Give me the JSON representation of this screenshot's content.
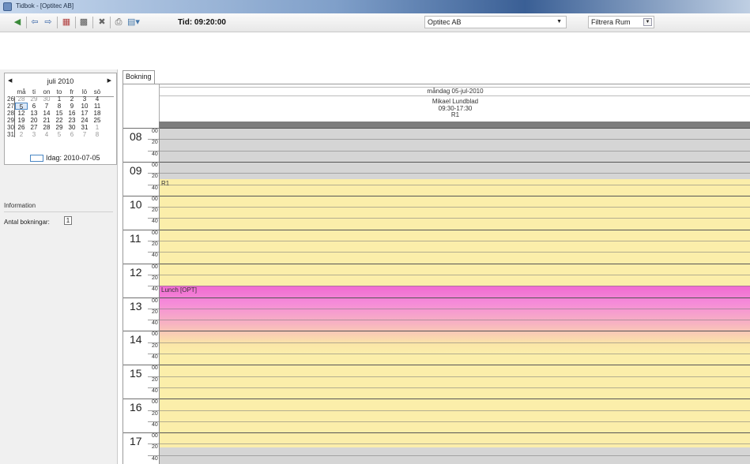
{
  "window": {
    "title": "Tidbok - [Optitec AB]"
  },
  "toolbar": {
    "icons": [
      "exit-icon",
      "back-icon",
      "forward-icon",
      "calendar-icon",
      "week-icon",
      "tools-icon",
      "print-icon",
      "report-icon"
    ],
    "time_label": "Tid: 09:20:00",
    "company": "Optitec AB",
    "filter": "Filtrera Rum"
  },
  "calendar": {
    "month": "juli 2010",
    "weekday_headers": [
      "må",
      "ti",
      "on",
      "to",
      "fr",
      "lö",
      "sö"
    ],
    "weeks": [
      {
        "week": "26",
        "days": [
          "28",
          "29",
          "30",
          "1",
          "2",
          "3",
          "4"
        ]
      },
      {
        "week": "27",
        "days": [
          "5",
          "6",
          "7",
          "8",
          "9",
          "10",
          "11"
        ]
      },
      {
        "week": "28",
        "days": [
          "12",
          "13",
          "14",
          "15",
          "16",
          "17",
          "18"
        ]
      },
      {
        "week": "29",
        "days": [
          "19",
          "20",
          "21",
          "22",
          "23",
          "24",
          "25"
        ]
      },
      {
        "week": "30",
        "days": [
          "26",
          "27",
          "28",
          "29",
          "30",
          "31",
          "1"
        ]
      },
      {
        "week": "31",
        "days": [
          "2",
          "3",
          "4",
          "5",
          "6",
          "7",
          "8"
        ]
      }
    ],
    "selected_day": "5",
    "today": "Idag: 2010-07-05"
  },
  "info": {
    "title": "Information",
    "bookings_label": "Antal bokningar:",
    "bookings_count": "1"
  },
  "schedule": {
    "tab": "Bokning",
    "date": "måndag 05-jul-2010",
    "person": "Mikael Lundblad",
    "hours_range": "09:30-17:30",
    "room": "R1",
    "hour_labels": [
      "08",
      "09",
      "10",
      "11",
      "12",
      "13",
      "14",
      "15",
      "16",
      "17"
    ],
    "minute_labels": [
      "00",
      "20",
      "40"
    ],
    "events": [
      {
        "label": "R1"
      },
      {
        "label": "Lunch [OPT]"
      }
    ]
  }
}
